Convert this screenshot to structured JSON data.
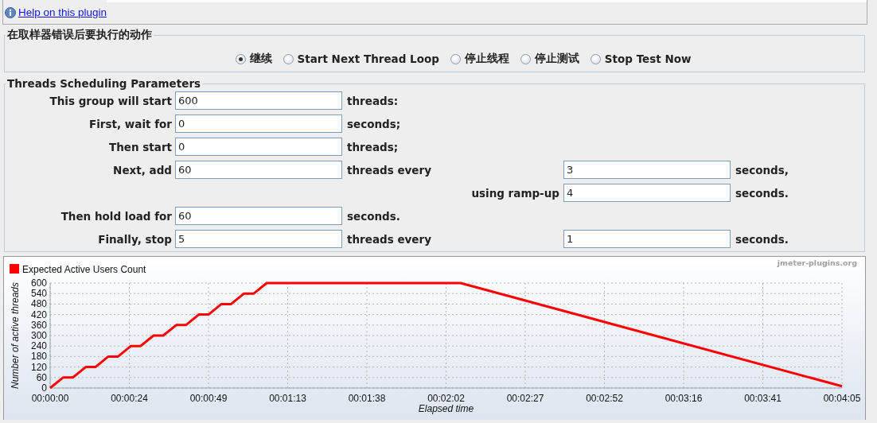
{
  "help_link": "Help on this plugin",
  "error_action": {
    "title": "在取样器错误后要执行的动作",
    "options": [
      {
        "label": "继续",
        "selected": true
      },
      {
        "label": "Start Next Thread Loop",
        "selected": false
      },
      {
        "label": "停止线程",
        "selected": false
      },
      {
        "label": "停止测试",
        "selected": false
      },
      {
        "label": "Stop Test Now",
        "selected": false
      }
    ]
  },
  "scheduling": {
    "title": "Threads Scheduling Parameters",
    "rows": [
      {
        "label": "This group will start",
        "value": "600",
        "unit": "threads:"
      },
      {
        "label": "First, wait for",
        "value": "0",
        "unit": "seconds;"
      },
      {
        "label": "Then start",
        "value": "0",
        "unit": "threads;"
      },
      {
        "label": "Next, add",
        "value": "60",
        "unit": "threads every",
        "second": {
          "value": "3",
          "unit": "seconds,"
        }
      },
      {
        "second": {
          "label": "using ramp-up",
          "value": "4",
          "unit": "seconds."
        }
      },
      {
        "label": "Then hold load for",
        "value": "60",
        "unit": "seconds."
      },
      {
        "label": "Finally, stop",
        "value": "5",
        "unit": "threads every",
        "second": {
          "value": "1",
          "unit": "seconds."
        }
      }
    ]
  },
  "chart": {
    "credit": "jmeter-plugins.org",
    "chart_data": {
      "type": "line",
      "grid": true,
      "xlabel": "Elapsed time",
      "ylabel": "Number of active threads",
      "x": [
        0,
        4,
        7,
        11,
        14,
        18,
        21,
        25,
        28,
        32,
        35,
        39,
        42,
        46,
        49,
        53,
        56,
        60,
        63,
        67,
        127,
        245
      ],
      "series": [
        {
          "name": "Expected Active Users Count",
          "color": "#ff0000",
          "values": [
            0,
            60,
            60,
            120,
            120,
            180,
            180,
            240,
            240,
            300,
            300,
            360,
            360,
            420,
            420,
            480,
            480,
            540,
            540,
            600,
            600,
            10
          ]
        }
      ],
      "xlim": [
        0,
        245
      ],
      "ylim": [
        0,
        600
      ],
      "xticks": [
        {
          "value": 0,
          "label": "00:00:00"
        },
        {
          "value": 24.5,
          "label": "00:00:24"
        },
        {
          "value": 49,
          "label": "00:00:49"
        },
        {
          "value": 73.5,
          "label": "00:01:13"
        },
        {
          "value": 98,
          "label": "00:01:38"
        },
        {
          "value": 122.5,
          "label": "00:02:02"
        },
        {
          "value": 147,
          "label": "00:02:27"
        },
        {
          "value": 171.5,
          "label": "00:02:52"
        },
        {
          "value": 196,
          "label": "00:03:16"
        },
        {
          "value": 220.5,
          "label": "00:03:41"
        },
        {
          "value": 245,
          "label": "00:04:05"
        }
      ],
      "yticks": [
        0,
        60,
        120,
        180,
        240,
        300,
        360,
        420,
        480,
        540,
        600
      ]
    }
  }
}
